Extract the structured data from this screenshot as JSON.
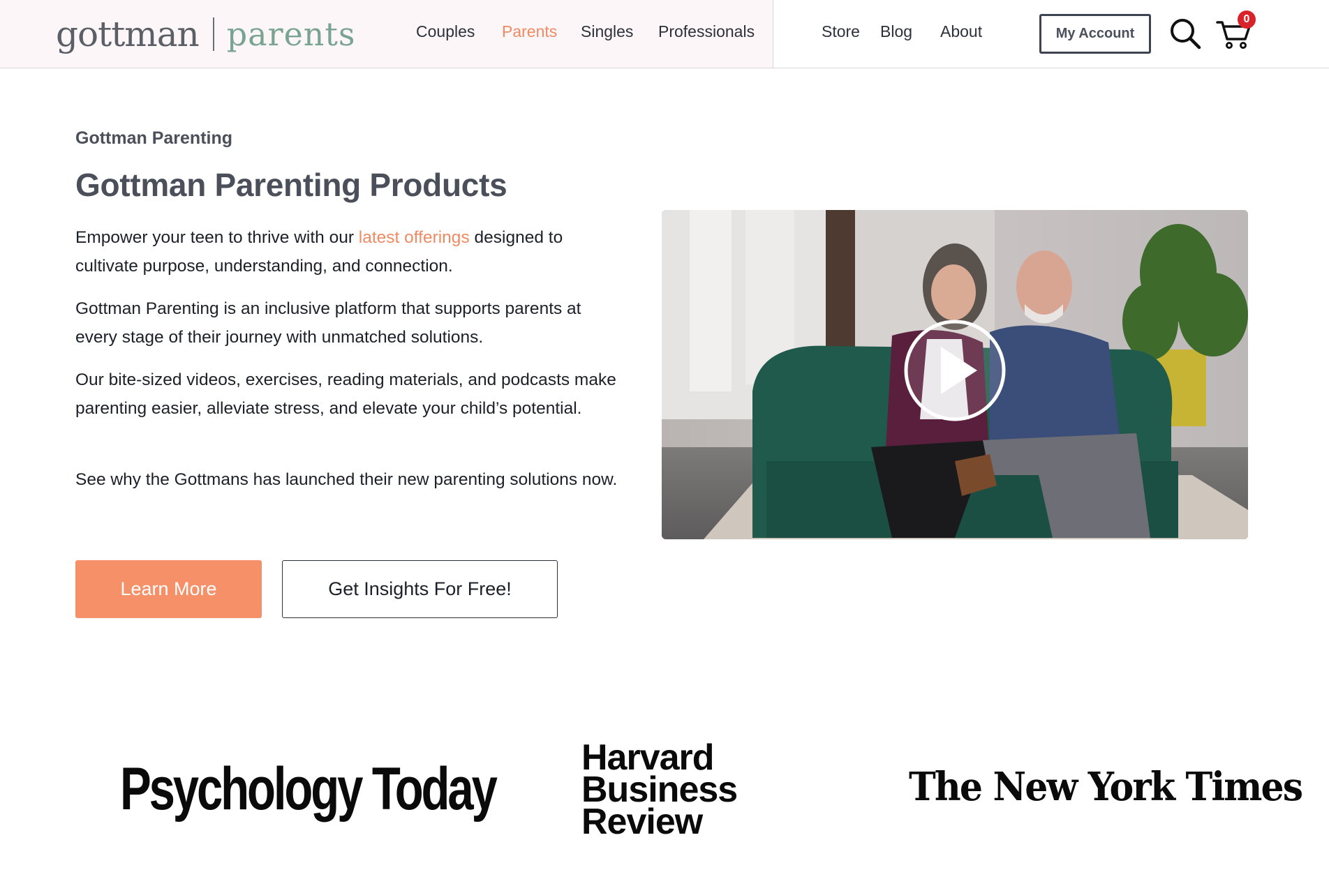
{
  "header": {
    "logo_main": "gottman",
    "logo_sub": "parents",
    "nav": [
      {
        "label": "Couples",
        "active": false
      },
      {
        "label": "Parents",
        "active": true
      },
      {
        "label": "Singles",
        "active": false
      },
      {
        "label": "Professionals",
        "active": false
      }
    ],
    "utility_nav": [
      {
        "label": "Store"
      },
      {
        "label": "Blog"
      },
      {
        "label": "About"
      }
    ],
    "account_label": "My Account",
    "search_icon": "search-icon",
    "cart_icon": "cart-icon",
    "cart_count": "0"
  },
  "hero": {
    "eyebrow": "Gottman Parenting",
    "title": "Gottman Parenting Products",
    "p1_before": "Empower your teen to thrive with our ",
    "p1_link": "latest offerings",
    "p1_after": " designed to cultivate purpose, understanding, and connection.",
    "p2": "Gottman Parenting is an inclusive platform that supports parents at every stage of their journey with unmatched solutions.",
    "p3": "Our bite-sized videos, exercises, reading materials, and podcasts make parenting easier, alleviate stress, and elevate your child’s potential.",
    "p4": "See why the Gottmans has launched their new parenting  solutions now.",
    "learn_more_label": "Learn More",
    "insights_label": "Get Insights For Free!",
    "video_play_icon": "play-icon"
  },
  "press": {
    "psychology_today": "Psychology Today",
    "hbr_lines": [
      "Harvard",
      "Business",
      "Review"
    ],
    "nyt": "The New York Times"
  },
  "colors": {
    "accent": "#f08a63",
    "logo_green": "#79a493",
    "header_tint": "#fdf6f9",
    "badge_red": "#d8232a"
  }
}
